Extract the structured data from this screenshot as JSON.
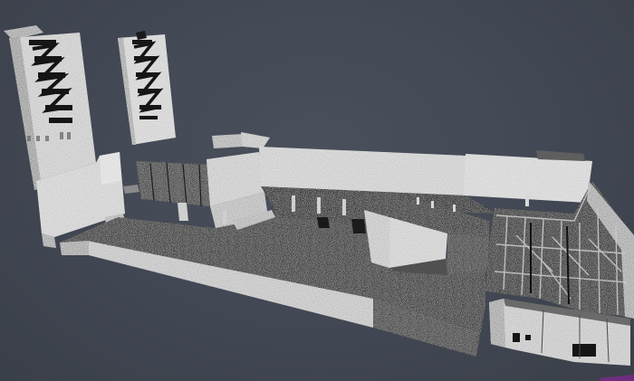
{
  "viewport": {
    "background_color": "#434955",
    "scene_description_icon": "point-cloud-scan"
  },
  "colors": {
    "cloud_light": "#d8d8d8",
    "cloud_mid": "#9a9a9a",
    "cloud_dark": "#3a3a3a",
    "cloud_black": "#161616",
    "selection_accent": "#7a2a8a"
  }
}
